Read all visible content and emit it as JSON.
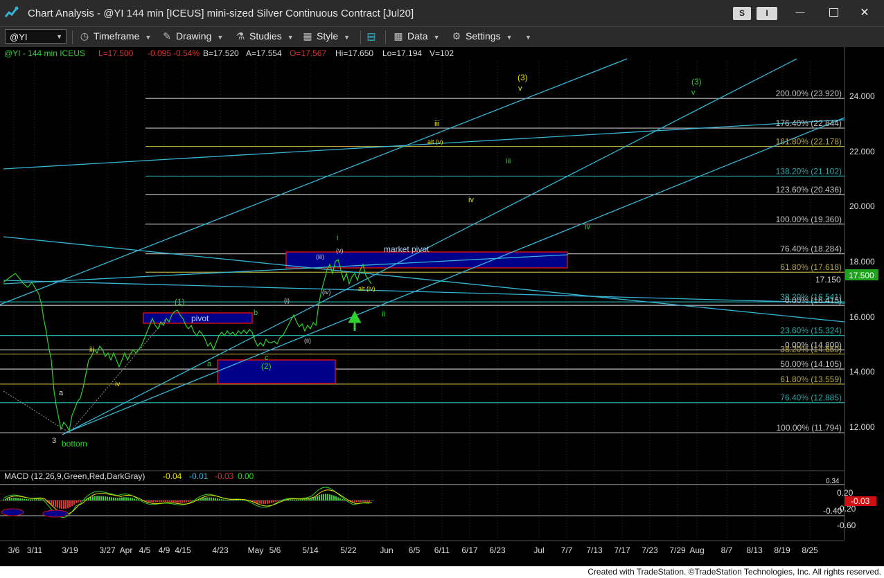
{
  "window": {
    "title": "Chart Analysis - @YI 144 min [ICEUS] mini-sized Silver Continuous Contract [Jul20]",
    "btn_s": "S",
    "btn_i": "I"
  },
  "toolbar": {
    "symbol": "@YI",
    "timeframe": "Timeframe",
    "drawing": "Drawing",
    "studies": "Studies",
    "style": "Style",
    "data": "Data",
    "settings": "Settings"
  },
  "quote": {
    "symbol": "@YI - 144 min  ICEUS",
    "last": "L=17.500",
    "chg": "-0.095",
    "pct": "-0.54%",
    "bid": "B=17.520",
    "ask": "A=17.554",
    "open": "O=17.567",
    "hi": "Hi=17.650",
    "lo": "Lo=17.194",
    "vol": "V=102"
  },
  "price_axis": {
    "ticks": [
      "24.000",
      "22.000",
      "20.000",
      "18.000",
      "16.000",
      "14.000",
      "12.000"
    ],
    "last_price": "17.500",
    "level_17150": "17.150"
  },
  "fib_levels": [
    {
      "label": "200.00% (23.920)",
      "color": "#c0c0c0"
    },
    {
      "label": "176.40% (22.844)",
      "color": "#c0c0c0"
    },
    {
      "label": "161.80% (22.178)",
      "color": "#b5a642"
    },
    {
      "label": "138.20% (21.102)",
      "color": "#2aa6a6"
    },
    {
      "label": "123.60% (20.436)",
      "color": "#c0c0c0"
    },
    {
      "label": "100.00% (19.360)",
      "color": "#c0c0c0"
    },
    {
      "label": "76.40% (18.284)",
      "color": "#c0c0c0"
    },
    {
      "label": "61.80% (17.618)",
      "color": "#b5a642"
    },
    {
      "label": "38.20% (16.541)",
      "color": "#2aa6a6"
    },
    {
      "label": "0.00% (16.415)",
      "color": "#c0c0c0"
    },
    {
      "label": "23.60% (15.324)",
      "color": "#2aa6a6"
    },
    {
      "label": "0.00% (14.800)",
      "color": "#c0c0c0"
    },
    {
      "label": "38.20% (14.650)",
      "color": "#b5a642"
    },
    {
      "label": "50.00% (14.105)",
      "color": "#c0c0c0"
    },
    {
      "label": "61.80% (13.559)",
      "color": "#b5a642"
    },
    {
      "label": "76.40% (12.885)",
      "color": "#2aa6a6"
    },
    {
      "label": "100.00% (11.794)",
      "color": "#c0c0c0"
    }
  ],
  "annotations": {
    "market_pivot": "market pivot",
    "pivot": "pivot",
    "bottom": "bottom",
    "yellow_3": "(3)",
    "yellow_v": "v",
    "yellow_iii": "iii",
    "yellow_alt_v": "alt (v)",
    "yellow_iv": "iv",
    "yellow_alt_iv": "alt (iv)",
    "green_3": "(3)",
    "green_v": "v",
    "green_iii": "iii",
    "green_iv": "iv",
    "green_i": "i",
    "green_ii": "ii",
    "green_1": "(1)",
    "green_2": "(2)",
    "a1": "a",
    "b1": "b",
    "c1": "c",
    "a2": "a",
    "three": "3",
    "iii_small": "iii",
    "iv_small": "iv",
    "w_i": "(i)",
    "w_ii": "(ii)",
    "w_iii": "(iii)",
    "w_iv": "(iv)",
    "w_v": "(v)"
  },
  "macd": {
    "title": "MACD (12,26,9,Green,Red,DarkGray)",
    "v1": "-0.04",
    "v2": "-0.01",
    "v3": "-0.03",
    "v4": "0.00",
    "ticks": [
      "0.20",
      "-0.20",
      "-0.40",
      "-0.60"
    ],
    "current": "-0.03",
    "clipped": "0.34"
  },
  "date_axis": [
    "3/6",
    "3/11",
    "3/19",
    "3/27",
    "Apr",
    "4/5",
    "4/9",
    "4/15",
    "4/23",
    "May",
    "5/6",
    "5/14",
    "5/22",
    "Jun",
    "6/5",
    "6/11",
    "6/17",
    "6/23",
    "Jul",
    "7/7",
    "7/13",
    "7/17",
    "7/23",
    "7/29",
    "Aug",
    "8/7",
    "8/13",
    "8/19",
    "8/25"
  ],
  "colors": {
    "green": "#2fd12f",
    "yellow": "#e8e000",
    "cyan": "#35b6d6",
    "pivot_box": "#00008b"
  },
  "footer": "Created with TradeStation. ©TradeStation Technologies, Inc. All rights reserved."
}
